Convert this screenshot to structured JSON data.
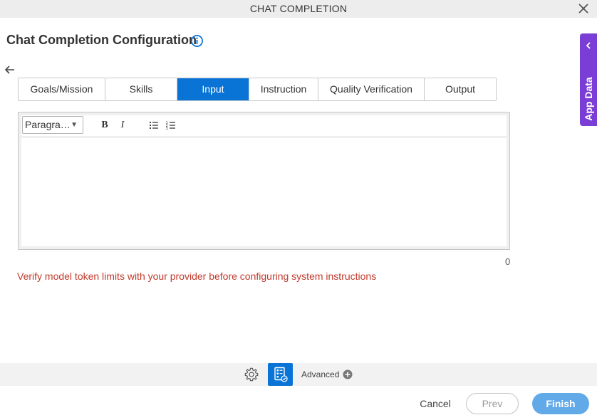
{
  "window": {
    "title": "CHAT COMPLETION",
    "close_icon": "close-icon"
  },
  "header": {
    "title": "Chat Completion Configuration",
    "info_icon": "info-icon",
    "back_icon": "back-arrow-icon"
  },
  "tabs": [
    {
      "label": "Goals/Mission",
      "active": false
    },
    {
      "label": "Skills",
      "active": false
    },
    {
      "label": "Input",
      "active": true
    },
    {
      "label": "Instruction",
      "active": false
    },
    {
      "label": "Quality Verification",
      "active": false
    },
    {
      "label": "Output",
      "active": false
    }
  ],
  "editor": {
    "format_value": "Paragra…",
    "bold_label": "B",
    "italic_label": "I",
    "bulleted_list_icon": "bulleted-list-icon",
    "numbered_list_icon": "numbered-list-icon",
    "content": "",
    "char_count": "0"
  },
  "warning": "Verify model token limits with your provider before configuring system instructions",
  "side_panel": {
    "label": "App Data",
    "chevron_icon": "chevron-left-icon"
  },
  "footer": {
    "gear_icon": "gear-icon",
    "form_icon": "form-checklist-icon",
    "advanced_label": "Advanced",
    "plus_icon": "plus-circle-icon"
  },
  "actions": {
    "cancel": "Cancel",
    "prev": "Prev",
    "finish": "Finish"
  },
  "colors": {
    "accent": "#0a74d6",
    "side_panel": "#7a3ed6",
    "warning": "#c0392b",
    "finish_button": "#62a9e8"
  }
}
